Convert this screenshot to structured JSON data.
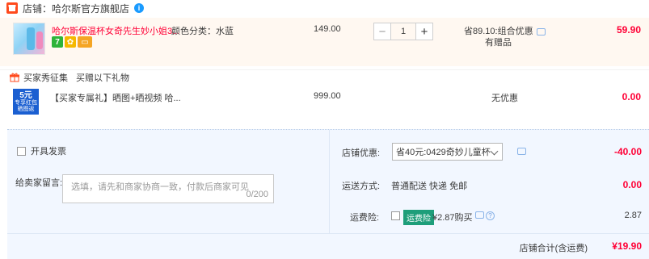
{
  "shop": {
    "label": "店铺：",
    "name": "哈尔斯官方旗舰店",
    "ww_icon": "info-icon",
    "icon_color": "#ff4a1d"
  },
  "item": {
    "title": "哈尔斯保温杯女奇先生妙小姐3...",
    "sku": "颜色分类：水蓝",
    "price": "149.00",
    "quantity": "1",
    "qty_minus": "−",
    "qty_plus": "+",
    "promo": "省89.10:组合优惠",
    "promo_sub": "有赠品",
    "total": "59.90",
    "badge_7": "7"
  },
  "gift_section": {
    "label1": "买家秀征集",
    "label2": "买赠以下礼物"
  },
  "gift_item": {
    "title": "【买家专属礼】晒图+晒视频 哈...",
    "thumb_big": "5元",
    "thumb_line1": "专享红包",
    "thumb_line2": "晒图返",
    "price": "999.00",
    "promo": "无优惠",
    "total": "0.00"
  },
  "order": {
    "invoice_label": "开具发票",
    "memo_label": "给卖家留言:",
    "memo_placeholder": "选填，请先和商家协商一致，付款后商家可见",
    "memo_count": "0/200",
    "coupon_label": "店铺优惠:",
    "coupon_value": "省40元:0429奇妙儿童杯",
    "coupon_amount": "-40.00",
    "ship_label": "运送方式:",
    "ship_value": "普通配送 快递 免邮",
    "ship_amount": "0.00",
    "insurance_label": "运费险:",
    "insurance_tag": "运费险",
    "insurance_text": "¥2.87购买",
    "insurance_amount": "2.87",
    "total_label": "店铺合计(含运费)",
    "total_amount": "¥19.90"
  },
  "colors": {
    "price_red": "#ff0036",
    "panel_bg": "#f2f7ff",
    "item_bg": "#fff8f1",
    "insurance_green": "#1e9e7a"
  }
}
